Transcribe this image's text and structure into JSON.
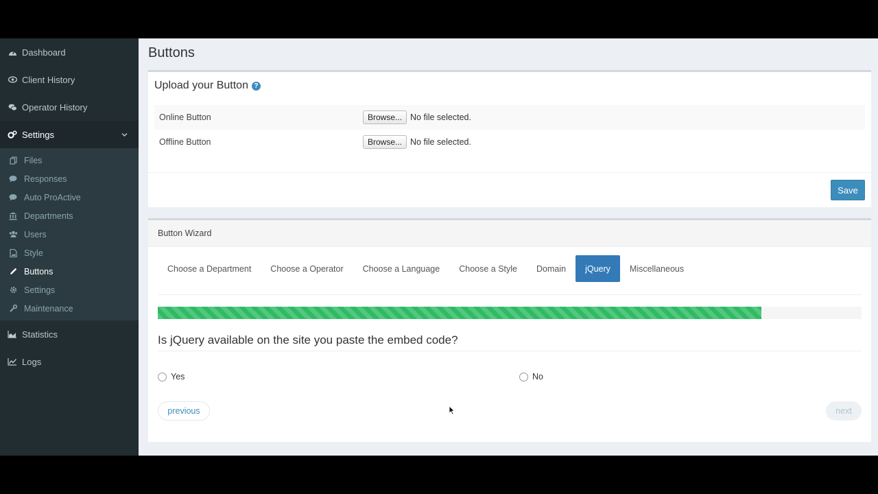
{
  "sidebar": {
    "items": [
      {
        "label": "Dashboard",
        "icon": "dashboard-icon"
      },
      {
        "label": "Client History",
        "icon": "eye-icon"
      },
      {
        "label": "Operator History",
        "icon": "comments-icon"
      },
      {
        "label": "Settings",
        "icon": "cogs-icon"
      }
    ],
    "submenu": [
      {
        "label": "Files",
        "icon": "files-icon"
      },
      {
        "label": "Responses",
        "icon": "comment-icon"
      },
      {
        "label": "Auto ProActive",
        "icon": "comment-icon"
      },
      {
        "label": "Departments",
        "icon": "bank-icon"
      },
      {
        "label": "Users",
        "icon": "users-icon"
      },
      {
        "label": "Style",
        "icon": "file-image-icon"
      },
      {
        "label": "Buttons",
        "icon": "pencil-icon"
      },
      {
        "label": "Settings",
        "icon": "gear-icon"
      },
      {
        "label": "Maintenance",
        "icon": "wrench-icon"
      }
    ],
    "bottom_items": [
      {
        "label": "Statistics",
        "icon": "area-chart-icon"
      },
      {
        "label": "Logs",
        "icon": "line-chart-icon"
      }
    ]
  },
  "page": {
    "title": "Buttons"
  },
  "upload": {
    "title": "Upload your Button",
    "rows": [
      {
        "label": "Online Button",
        "browse": "Browse...",
        "status": "No file selected."
      },
      {
        "label": "Offline Button",
        "browse": "Browse...",
        "status": "No file selected."
      }
    ],
    "save_label": "Save"
  },
  "wizard": {
    "header": "Button Wizard",
    "tabs": [
      "Choose a Department",
      "Choose a Operator",
      "Choose a Language",
      "Choose a Style",
      "Domain",
      "jQuery",
      "Miscellaneous"
    ],
    "active_tab": "jQuery",
    "progress_fraction": 0.858,
    "question": "Is jQuery available on the site you paste the embed code?",
    "options": [
      "Yes",
      "No"
    ],
    "previous_label": "previous",
    "next_label": "next"
  },
  "colors": {
    "accent": "#3c8dbc",
    "progress": "#2ebb63",
    "sidebar": "#222d32"
  }
}
